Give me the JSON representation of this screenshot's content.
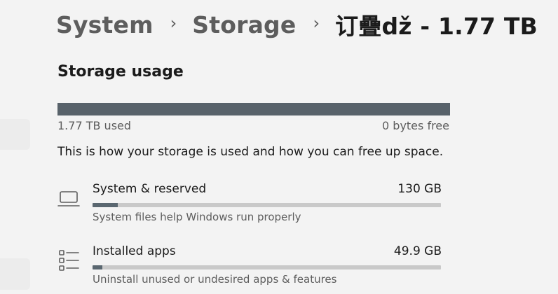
{
  "breadcrumb": {
    "items": [
      "System",
      "Storage",
      "订疊dž - 1.77 TB"
    ]
  },
  "storage_usage": {
    "title": "Storage usage",
    "used_label": "1.77 TB used",
    "free_label": "0 bytes free",
    "used_fraction": 1.0,
    "description": "This is how your storage is used and how you can free up space."
  },
  "categories": [
    {
      "name": "System & reserved",
      "size": "130 GB",
      "subtitle": "System files help Windows run properly",
      "icon": "laptop-icon",
      "fill_fraction": 0.072
    },
    {
      "name": "Installed apps",
      "size": "49.9 GB",
      "subtitle": "Uninstall unused or undesired apps & features",
      "icon": "apps-list-icon",
      "fill_fraction": 0.028
    }
  ],
  "colors": {
    "bar_fill": "#58626a",
    "bar_track": "#c9c9c9",
    "background": "#f3f3f3"
  }
}
